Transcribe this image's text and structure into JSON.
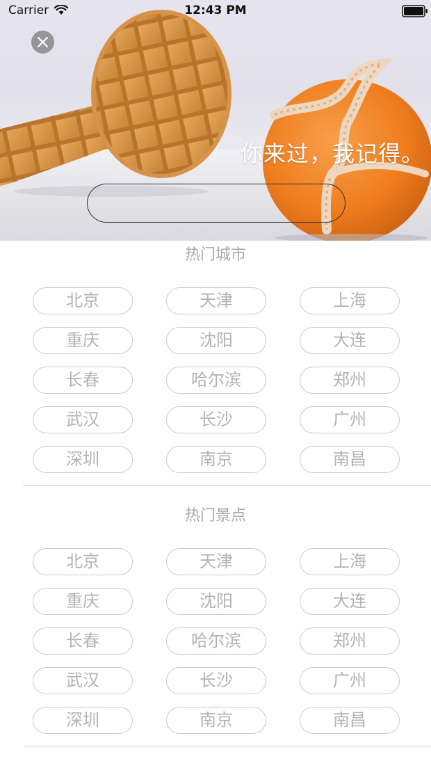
{
  "status_bar": {
    "carrier": "Carrier",
    "time": "12:43 PM"
  },
  "hero": {
    "tagline": "你来过，我记得。",
    "search_value": ""
  },
  "sections": [
    {
      "title": "热门城市",
      "items": [
        "北京",
        "天津",
        "上海",
        "重庆",
        "沈阳",
        "大连",
        "长春",
        "哈尔滨",
        "郑州",
        "武汉",
        "长沙",
        "广州",
        "深圳",
        "南京",
        "南昌"
      ]
    },
    {
      "title": "热门景点",
      "items": [
        "北京",
        "天津",
        "上海",
        "重庆",
        "沈阳",
        "大连",
        "长春",
        "哈尔滨",
        "郑州",
        "武汉",
        "长沙",
        "广州",
        "深圳",
        "南京",
        "南昌"
      ]
    }
  ],
  "colors": {
    "chip_border": "#c9c9c9",
    "chip_text": "#b3b3b3",
    "section_title": "#a9a9a9",
    "divider": "#d2d2d2",
    "orange": "#f08a2c"
  }
}
